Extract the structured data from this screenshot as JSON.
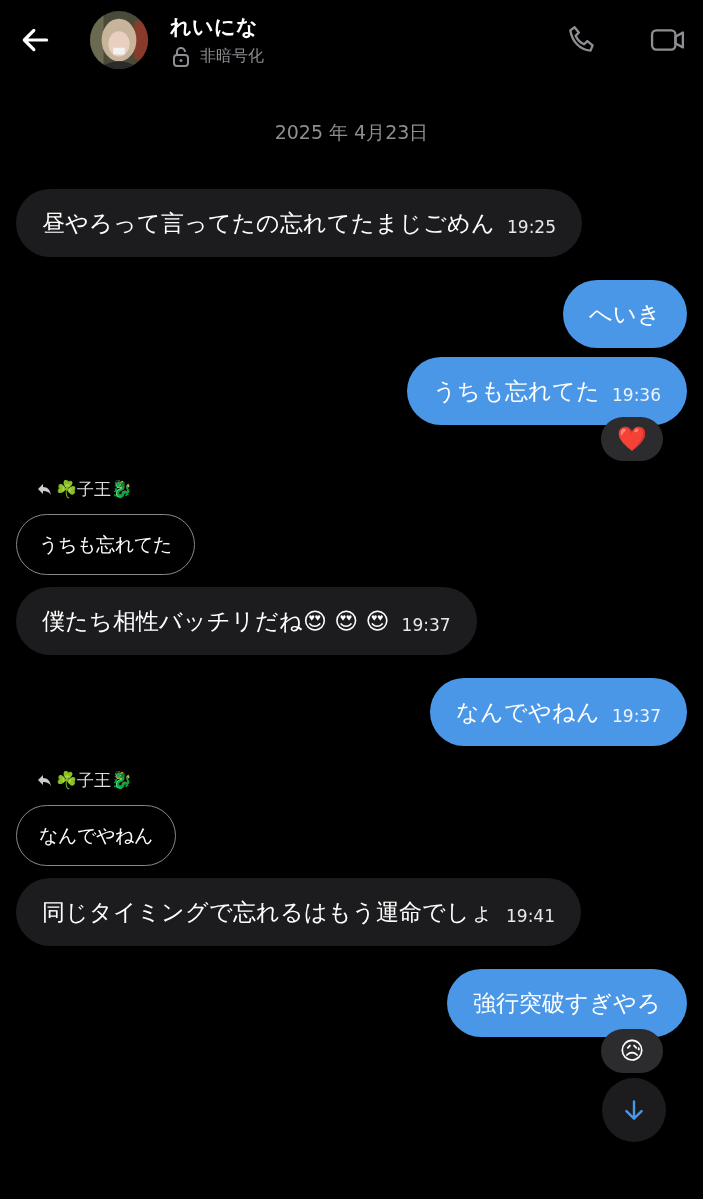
{
  "header": {
    "name": "れいにな",
    "status": "非暗号化"
  },
  "date": "2025 年 4月23日",
  "messages": [
    {
      "kind": "incoming",
      "text": "昼やろって言ってたの忘れてたまじごめん",
      "time": "19:25"
    },
    {
      "kind": "outgoing",
      "text": "へいき"
    },
    {
      "kind": "outgoing",
      "text": "うちも忘れてた",
      "time": "19:36",
      "reaction": "❤️"
    },
    {
      "kind": "reply_quote",
      "sender": "☘️子王🐉",
      "text": "うちも忘れてた"
    },
    {
      "kind": "incoming",
      "text": "僕たち相性バッチリだね😍 😍 😍",
      "time": "19:37"
    },
    {
      "kind": "outgoing",
      "text": "なんでやねん",
      "time": "19:37"
    },
    {
      "kind": "reply_quote",
      "sender": "☘️子王🐉",
      "text": "なんでやねん"
    },
    {
      "kind": "incoming",
      "text": "同じタイミングで忘れるはもう運命でしょ",
      "time": "19:41"
    },
    {
      "kind": "outgoing",
      "text": "強行突破すぎやろ",
      "reaction": "😥"
    }
  ]
}
